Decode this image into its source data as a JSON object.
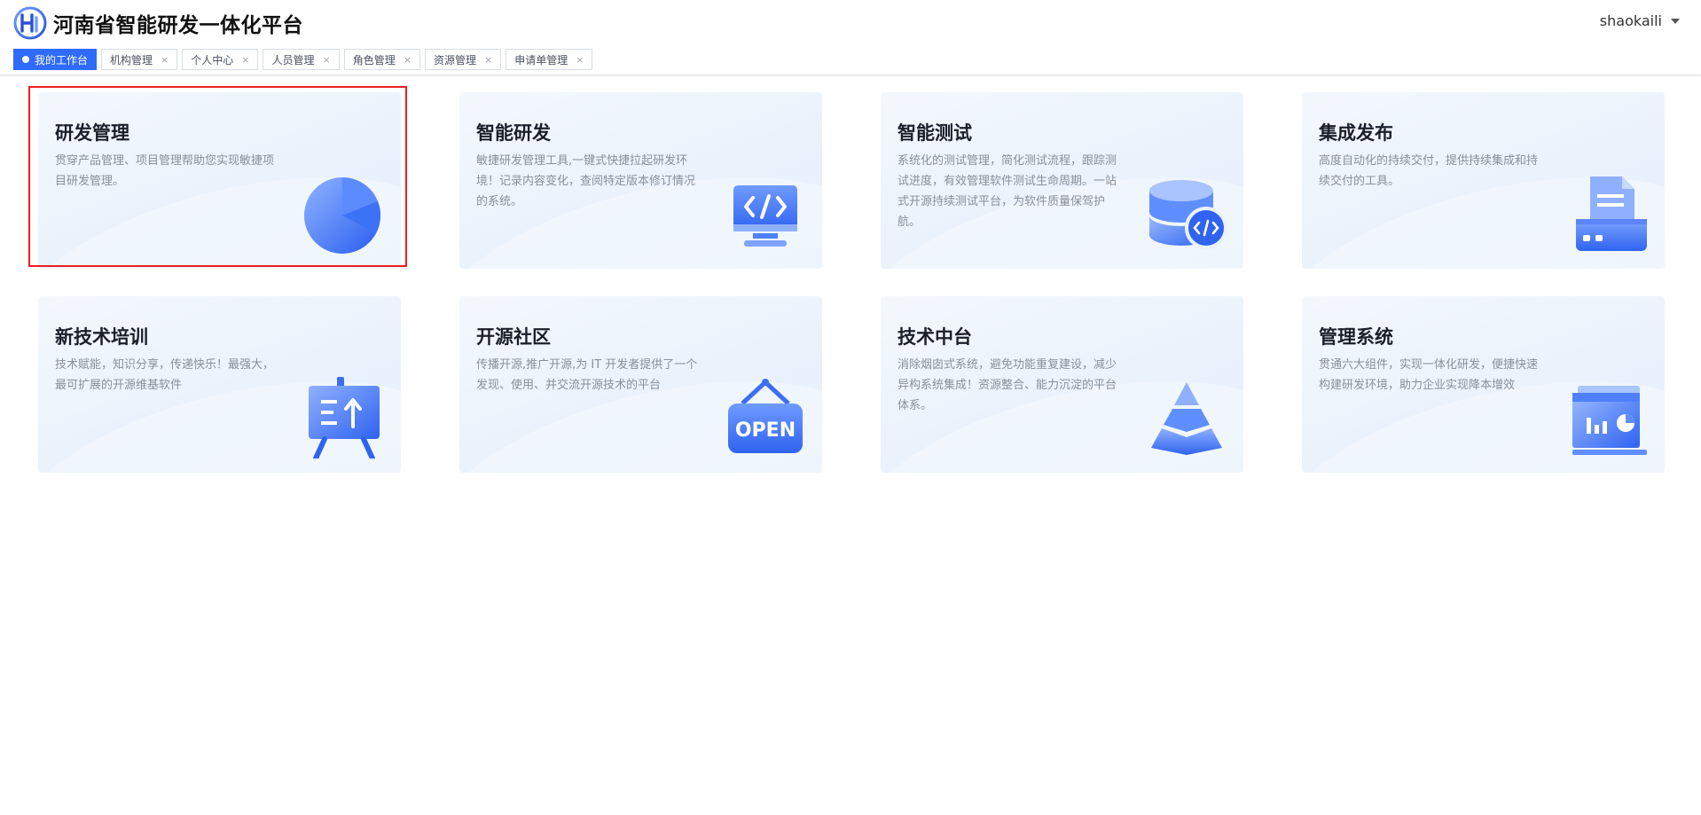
{
  "app": {
    "title": "河南省智能研发一体化平台",
    "logo_text": "H"
  },
  "user": {
    "name": "shaokaili"
  },
  "tabs": [
    {
      "label": "我的工作台",
      "active": true
    },
    {
      "label": "机构管理",
      "close": "×"
    },
    {
      "label": "个人中心",
      "close": "×"
    },
    {
      "label": "人员管理",
      "close": "×"
    },
    {
      "label": "角色管理",
      "close": "×"
    },
    {
      "label": "资源管理",
      "close": "×"
    },
    {
      "label": "申请单管理",
      "close": "×"
    }
  ],
  "cards": [
    {
      "title": "研发管理",
      "desc": "贯穿产品管理、项目管理帮助您实现敏捷项目研发管理。",
      "icon": "pie-chart-icon",
      "selected": true
    },
    {
      "title": "智能研发",
      "desc": "敏捷研发管理工具,一键式快捷拉起研发环境！记录内容变化，查阅特定版本修订情况的系统。",
      "icon": "code-monitor-icon"
    },
    {
      "title": "智能测试",
      "desc": "系统化的测试管理，简化测试流程，跟踪测试进度，有效管理软件测试生命周期。一站式开源持续测试平台，为软件质量保驾护航。",
      "icon": "database-code-icon"
    },
    {
      "title": "集成发布",
      "desc": "高度自动化的持续交付，提供持续集成和持续交付的工具。",
      "icon": "printer-document-icon"
    },
    {
      "title": "新技术培训",
      "desc": "技术赋能，知识分享，传递快乐！最强大，最可扩展的开源维基软件",
      "icon": "presentation-board-icon"
    },
    {
      "title": "开源社区",
      "desc": "传播开源,推广开源,为 IT 开发者提供了一个发现、使用、并交流开源技术的平台",
      "icon": "open-sign-icon",
      "icon_text": "OPEN"
    },
    {
      "title": "技术中台",
      "desc": "消除烟囱式系统，避免功能重复建设，减少异构系统集成！资源整合、能力沉淀的平台体系。",
      "icon": "pyramid-layers-icon"
    },
    {
      "title": "管理系统",
      "desc": "贯通六大组件，实现一体化研发，便捷快速构建研发环境，助力企业实现降本增效",
      "icon": "dashboard-window-icon"
    }
  ],
  "colors": {
    "accent": "#2f6bff",
    "icon_light": "#8fb0ff",
    "icon_dark": "#2f63f0",
    "highlight": "#ee1c24"
  }
}
